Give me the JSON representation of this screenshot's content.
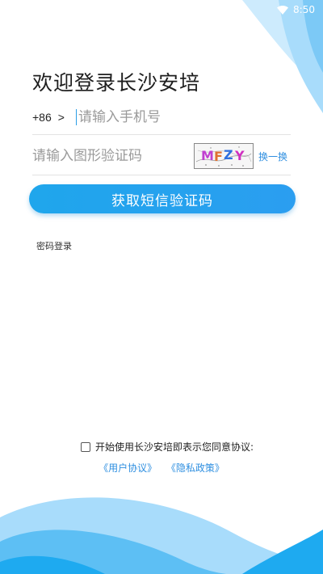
{
  "status_bar": {
    "time": "8:50",
    "wifi_icon": "wifi-icon"
  },
  "title": "欢迎登录长沙安培",
  "phone": {
    "country_code": "+86",
    "chevron": ">",
    "placeholder": "请输入手机号"
  },
  "captcha": {
    "placeholder": "请输入图形验证码",
    "image_text": "MFZY",
    "refresh_label": "换一换"
  },
  "submit_label": "获取短信验证码",
  "password_login_label": "密码登录",
  "agreement": {
    "text": "开始使用长沙安培即表示您同意协议:",
    "user_agreement": "《用户协议》",
    "privacy_policy": "《隐私政策》"
  },
  "colors": {
    "accent": "#2b9ef0",
    "link": "#2f8fe0",
    "deco_light": "#a8dcfb",
    "deco_dark": "#1eaaf0"
  }
}
